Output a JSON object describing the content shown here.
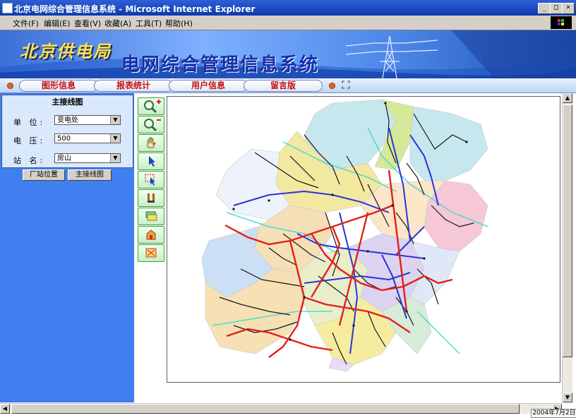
{
  "window": {
    "title": "北京电网综合管理信息系统 - Microsoft Internet Explorer",
    "controls": {
      "minimize": "_",
      "maximize": "□",
      "close": "×"
    }
  },
  "menu": {
    "items": [
      "文件(F)",
      "编辑(E)",
      "查看(V)",
      "收藏(A)",
      "工具(T)",
      "帮助(H)"
    ]
  },
  "banner": {
    "logo": "北京供电局",
    "system_title": "电网综合管理信息系统"
  },
  "tabs": [
    "图形信息",
    "报表统计",
    "用户信息",
    "留言版"
  ],
  "panel": {
    "title": "主接线图",
    "fields": [
      {
        "label": "单  位:",
        "value": "变电处"
      },
      {
        "label": "电  压:",
        "value": "500"
      },
      {
        "label": "站  名:",
        "value": "房山"
      }
    ],
    "buttons": [
      "厂站位置",
      "主接线图"
    ]
  },
  "tools": [
    "zoom-in-icon",
    "zoom-out-icon",
    "pan-hand-icon",
    "select-arrow-icon",
    "select-box-icon",
    "measure-icon",
    "layers-icon",
    "station-icon",
    "full-extent-icon"
  ],
  "status": {
    "date": "2004年7月2日"
  },
  "colors": {
    "line_500kv": "#e0201a",
    "line_220kv": "#2030d0",
    "line_110kv": "#101010",
    "line_cyan": "#40d8d0",
    "title_bar": "#0a3ab0",
    "panel_bg": "#3f7ff0"
  },
  "map": {
    "districts": [
      "北京行政区划"
    ]
  }
}
